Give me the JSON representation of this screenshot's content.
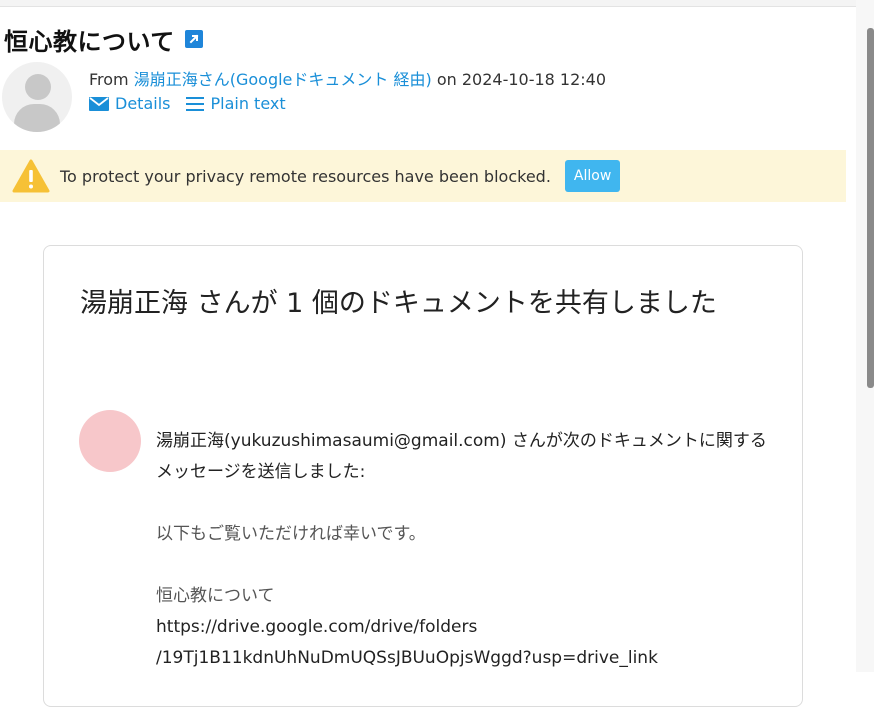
{
  "subject": "恒心教について",
  "header": {
    "from_prefix": "From",
    "sender_name": "湯崩正海さん(Googleドキュメント 経由)",
    "date_prefix": "on",
    "date": "2024-10-18 12:40",
    "details_label": "Details",
    "plain_text_label": "Plain text"
  },
  "banner": {
    "text": "To protect your privacy remote resources have been blocked.",
    "allow_label": "Allow",
    "background": "#fdf6d9",
    "button_color": "#40b6ef"
  },
  "card": {
    "title": "湯崩正海 さんが 1 個のドキュメントを共有しました",
    "sender_line": "湯崩正海(yukuzushimasaumi@gmail.com) さんが次のドキュメントに関するメッセージを送信しました:",
    "message": "以下もご覧いただければ幸いです。",
    "doc_name": "恒心教について",
    "link_part1": "https://drive.google.com/drive/folders",
    "link_part2": "/19Tj1B11kdnUhNuDmUQSsJBUuOpjsWggd?usp=drive_link"
  },
  "colors": {
    "accent": "#1a8fd8",
    "avatar_pink": "#f7c7ca"
  },
  "icons": [
    "external-link-icon",
    "envelope-icon",
    "list-icon",
    "warning-icon",
    "default-avatar-icon"
  ]
}
